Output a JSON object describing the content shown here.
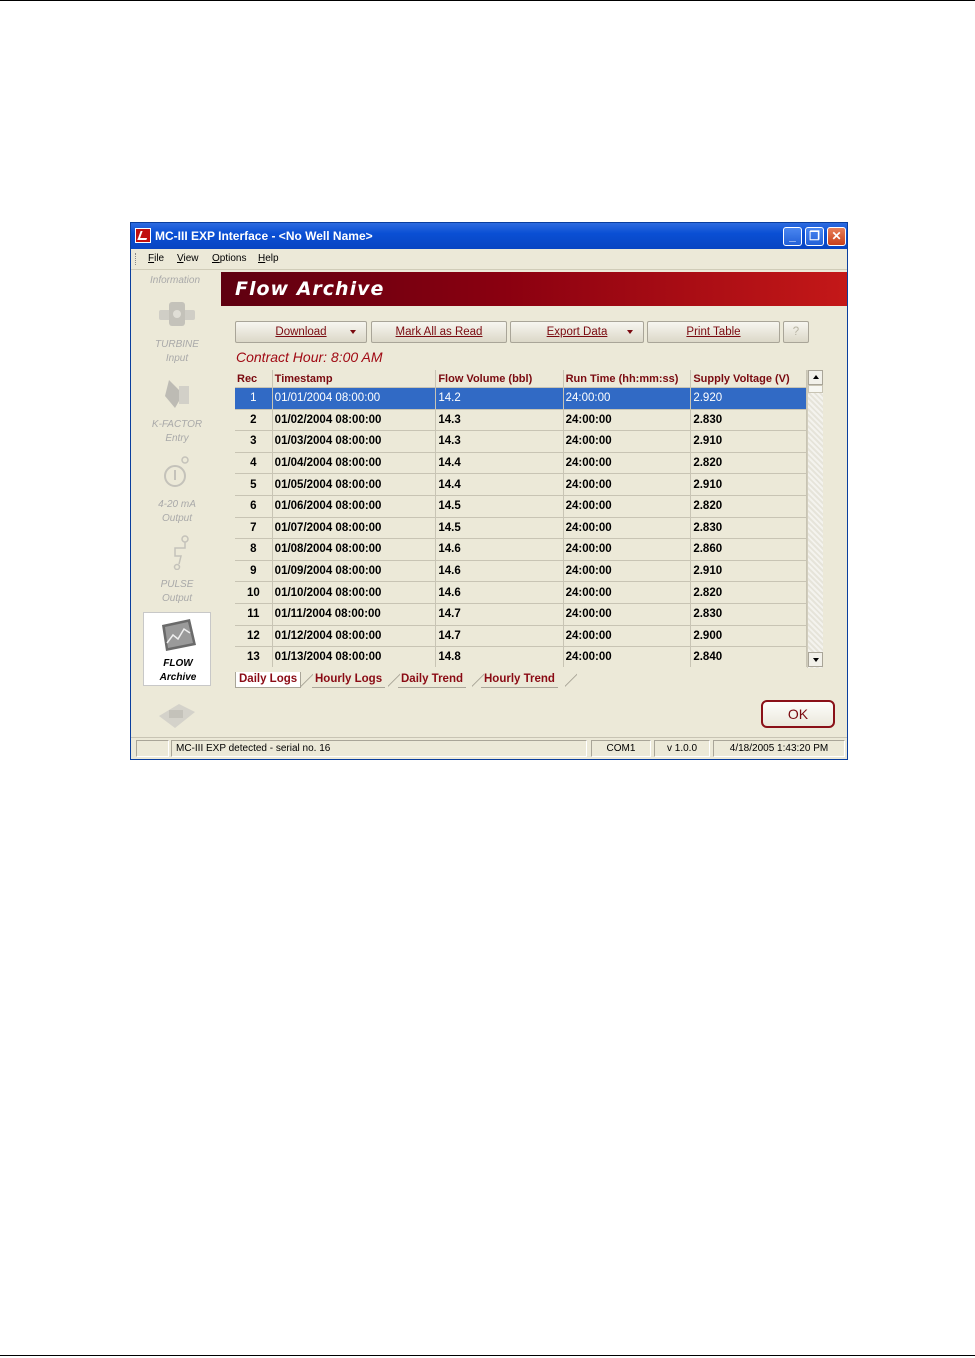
{
  "window": {
    "title": "MC-III EXP Interface - <No Well Name>",
    "minimize_icon": "minimize-icon",
    "restore_icon": "restore-icon",
    "close_icon": "close-icon",
    "close_glyph": "✕",
    "min_glyph": "_",
    "max_glyph": "❐"
  },
  "menu": {
    "items": [
      {
        "key": "F",
        "rest": "ile"
      },
      {
        "key": "V",
        "rest": "iew"
      },
      {
        "key": "O",
        "rest": "ptions"
      },
      {
        "key": "H",
        "rest": "elp"
      }
    ]
  },
  "nav": {
    "info_label": "Information",
    "items": [
      {
        "line1": "TURBINE",
        "line2": "Input",
        "icon": "turbine-icon"
      },
      {
        "line1": "K-FACTOR",
        "line2": "Entry",
        "icon": "k-factor-icon"
      },
      {
        "line1": "4-20 mA",
        "line2": "Output",
        "icon": "analog-output-icon"
      },
      {
        "line1": "PULSE",
        "line2": "Output",
        "icon": "pulse-output-icon"
      },
      {
        "line1": "FLOW",
        "line2": "Archive",
        "icon": "flow-archive-icon",
        "active": true
      }
    ]
  },
  "header": {
    "title": "Flow Archive"
  },
  "toolbar": {
    "download": "Download",
    "mark_all": "Mark All as Read",
    "export": "Export Data",
    "print": "Print Table",
    "help": "?"
  },
  "contract_hour": "Contract Hour:  8:00 AM",
  "table": {
    "columns": [
      "Rec",
      "Timestamp",
      "Flow Volume (bbl)",
      "Run Time (hh:mm:ss)",
      "Supply Voltage (V)"
    ],
    "rows": [
      [
        "1",
        "01/01/2004 08:00:00",
        "14.2",
        "24:00:00",
        "2.920"
      ],
      [
        "2",
        "01/02/2004 08:00:00",
        "14.3",
        "24:00:00",
        "2.830"
      ],
      [
        "3",
        "01/03/2004 08:00:00",
        "14.3",
        "24:00:00",
        "2.910"
      ],
      [
        "4",
        "01/04/2004 08:00:00",
        "14.4",
        "24:00:00",
        "2.820"
      ],
      [
        "5",
        "01/05/2004 08:00:00",
        "14.4",
        "24:00:00",
        "2.910"
      ],
      [
        "6",
        "01/06/2004 08:00:00",
        "14.5",
        "24:00:00",
        "2.820"
      ],
      [
        "7",
        "01/07/2004 08:00:00",
        "14.5",
        "24:00:00",
        "2.830"
      ],
      [
        "8",
        "01/08/2004 08:00:00",
        "14.6",
        "24:00:00",
        "2.860"
      ],
      [
        "9",
        "01/09/2004 08:00:00",
        "14.6",
        "24:00:00",
        "2.910"
      ],
      [
        "10",
        "01/10/2004 08:00:00",
        "14.6",
        "24:00:00",
        "2.820"
      ],
      [
        "11",
        "01/11/2004 08:00:00",
        "14.7",
        "24:00:00",
        "2.830"
      ],
      [
        "12",
        "01/12/2004 08:00:00",
        "14.7",
        "24:00:00",
        "2.900"
      ],
      [
        "13",
        "01/13/2004 08:00:00",
        "14.8",
        "24:00:00",
        "2.840"
      ]
    ],
    "selected_row": 0
  },
  "tabs": [
    "Daily Logs",
    "Hourly Logs",
    "Daily Trend",
    "Hourly Trend"
  ],
  "ok_button": "OK",
  "status": {
    "message": "MC-III EXP detected - serial no. 16",
    "port": "COM1",
    "version": "v 1.0.0",
    "datetime": "4/18/2005 1:43:20 PM"
  },
  "colors": {
    "accent": "#8a0010",
    "selection": "#316ac5",
    "titlebar": "#0a4fd4"
  }
}
